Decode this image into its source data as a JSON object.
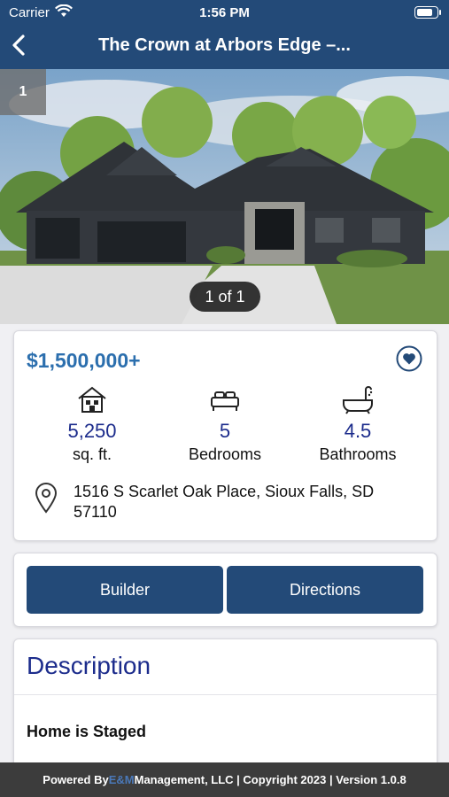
{
  "status_bar": {
    "carrier": "Carrier",
    "time": "1:56 PM",
    "battery_level": 0.9
  },
  "header": {
    "title": "The Crown at Arbors Edge –..."
  },
  "gallery": {
    "photo_index": "1",
    "pager": "1 of 1"
  },
  "listing": {
    "price": "$1,500,000+",
    "stats": [
      {
        "icon": "house-icon",
        "value": "5,250",
        "label": "sq. ft."
      },
      {
        "icon": "bed-icon",
        "value": "5",
        "label": "Bedrooms"
      },
      {
        "icon": "bathtub-icon",
        "value": "4.5",
        "label": "Bathrooms"
      }
    ],
    "address": "1516 S Scarlet Oak Place, Sioux Falls, SD 57110"
  },
  "actions": {
    "builder_label": "Builder",
    "directions_label": "Directions"
  },
  "description": {
    "title": "Description",
    "text": "Home is Staged"
  },
  "footer": {
    "prefix": "Powered By ",
    "brand": "E&M",
    "suffix": " Management, LLC | Copyright 2023 | Version 1.0.8"
  },
  "colors": {
    "nav": "#234a78",
    "price": "#2c6fae",
    "stat": "#1c2c8c",
    "footer": "#3c3c3c"
  }
}
